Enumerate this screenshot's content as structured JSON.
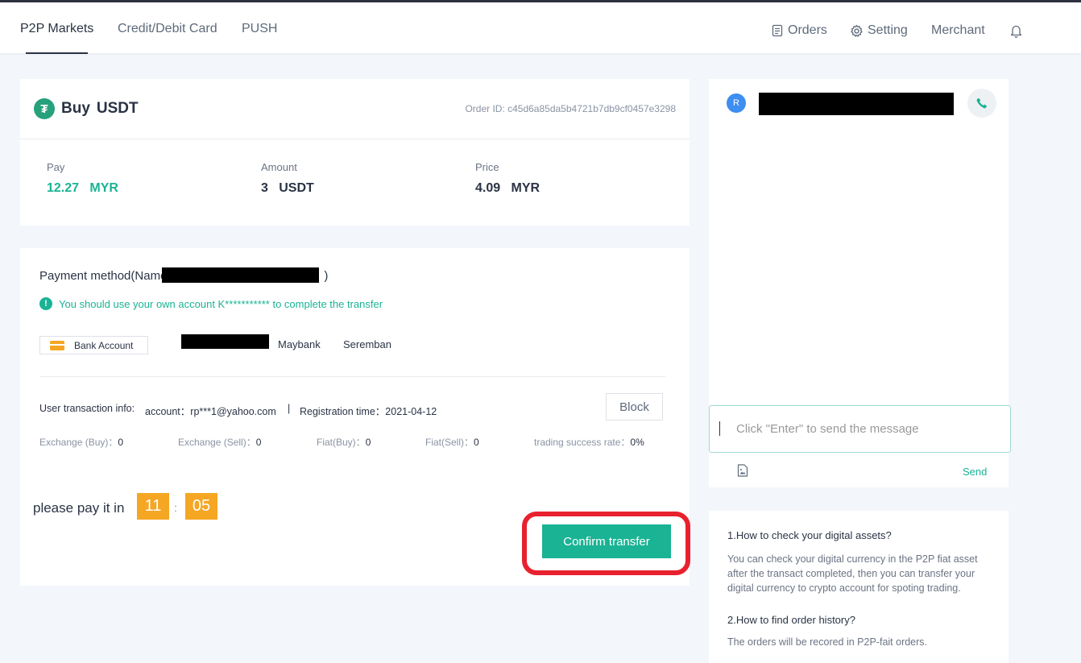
{
  "nav": {
    "tabs": [
      "P2P Markets",
      "Credit/Debit Card",
      "PUSH"
    ],
    "orders": "Orders",
    "setting": "Setting",
    "merchant": "Merchant"
  },
  "order": {
    "action": "Buy",
    "coin": "USDT",
    "coin_symbol": "₮",
    "order_id": "Order ID: c45d6a85da5b4721b7db9cf0457e3298",
    "pay_label": "Pay",
    "pay_value": "12.27",
    "pay_currency": "MYR",
    "amount_label": "Amount",
    "amount_value": "3",
    "amount_currency": "USDT",
    "price_label": "Price",
    "price_value": "4.09",
    "price_currency": "MYR"
  },
  "payment": {
    "title_prefix": "Payment method(Name",
    "title_suffix": ")",
    "notice": "You should use your own account K*********** to complete the transfer",
    "method": "Bank Account",
    "bank": "Maybank",
    "branch": "Seremban",
    "user_info": "User transaction info:",
    "account": "account：rp***1@yahoo.com",
    "divider": "|",
    "registration": "Registration time：2021-04-12",
    "block": "Block",
    "stats": [
      {
        "label": "Exchange (Buy)：",
        "value": "0"
      },
      {
        "label": "Exchange (Sell)：",
        "value": "0"
      },
      {
        "label": "Fiat(Buy)：",
        "value": "0"
      },
      {
        "label": "Fiat(Sell)：",
        "value": "0"
      },
      {
        "label": "trading success rate：",
        "value": "0%"
      }
    ]
  },
  "timer": {
    "label": "please pay it in",
    "minutes": "11",
    "separator": ":",
    "seconds": "05"
  },
  "confirm": "Confirm transfer",
  "chat": {
    "avatar": "R",
    "placeholder": "Click \"Enter\" to send the message",
    "send": "Send"
  },
  "faq": [
    {
      "q": "1.How to check your digital assets?",
      "a": "You can check your digital currency in the P2P fiat asset after the transact completed, then you can transfer your digital currency to crypto account for spoting trading."
    },
    {
      "q": "2.How to find order history?",
      "a": "The orders will be recored in P2P-fait orders."
    }
  ],
  "colors": {
    "accent": "#1ab394",
    "timer": "#f5a623",
    "highlight": "#e8212f"
  }
}
